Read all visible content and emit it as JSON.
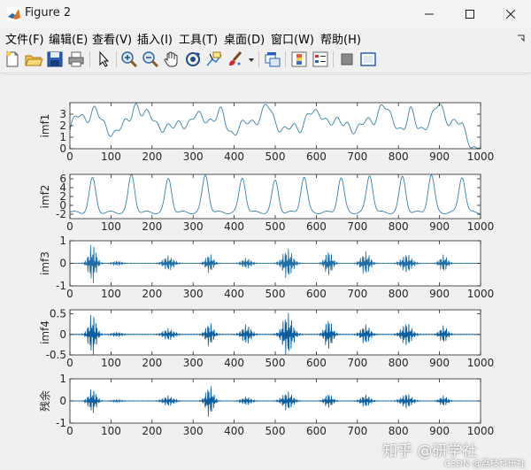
{
  "window": {
    "title": "Figure 2"
  },
  "menu": [
    "文件(F)",
    "编辑(E)",
    "查看(V)",
    "插入(I)",
    "工具(T)",
    "桌面(D)",
    "窗口(W)",
    "帮助(H)"
  ],
  "toolbar_icons": [
    "new-file-icon",
    "open-folder-icon",
    "save-icon",
    "print-icon",
    "pointer-icon",
    "zoom-in-icon",
    "zoom-out-icon",
    "pan-hand-icon",
    "rotate-3d-icon",
    "data-cursor-icon",
    "brush-icon",
    "brush-dropdown-icon",
    "link-plot-icon",
    "colorbar-icon",
    "legend-icon",
    "hide-plot-tools-icon",
    "show-plot-tools-icon"
  ],
  "chart_data": [
    {
      "type": "line",
      "ylabel": "imf1",
      "xlim": [
        0,
        1000
      ],
      "ylim": [
        0,
        4
      ],
      "yticks": [
        "0",
        "1",
        "2",
        "3"
      ],
      "xticks": [
        "0",
        "100",
        "200",
        "300",
        "400",
        "500",
        "600",
        "700",
        "800",
        "900",
        "1000"
      ],
      "style": "smooth",
      "series": [
        {
          "color": "#3a80a8"
        }
      ]
    },
    {
      "type": "line",
      "ylabel": "imf2",
      "xlim": [
        0,
        1000
      ],
      "ylim": [
        -3,
        7
      ],
      "yticks": [
        "-2",
        "0",
        "2",
        "4",
        "6"
      ],
      "xticks": [
        "0",
        "100",
        "200",
        "300",
        "400",
        "500",
        "600",
        "700",
        "800",
        "900",
        "1000"
      ],
      "style": "peaks",
      "series": [
        {
          "color": "#3a80a8"
        }
      ]
    },
    {
      "type": "line",
      "ylabel": "imf3",
      "xlim": [
        0,
        1000
      ],
      "ylim": [
        -1,
        1
      ],
      "yticks": [
        "-1",
        "0",
        "1"
      ],
      "xticks": [
        "0",
        "100",
        "200",
        "300",
        "400",
        "500",
        "600",
        "700",
        "800",
        "900",
        "1000"
      ],
      "style": "bursts",
      "series": [
        {
          "color": "#1f6fa6"
        }
      ]
    },
    {
      "type": "line",
      "ylabel": "imf4",
      "xlim": [
        0,
        1000
      ],
      "ylim": [
        -0.5,
        0.6
      ],
      "yticks": [
        "-0.5",
        "0",
        "0.5"
      ],
      "xticks": [
        "0",
        "100",
        "200",
        "300",
        "400",
        "500",
        "600",
        "700",
        "800",
        "900",
        "1000"
      ],
      "style": "bursts",
      "series": [
        {
          "color": "#0b5fa0"
        }
      ]
    },
    {
      "type": "line",
      "ylabel": "残余",
      "xlim": [
        0,
        1000
      ],
      "ylim": [
        -1,
        1
      ],
      "yticks": [
        "-1",
        "0",
        "1"
      ],
      "xticks": [
        "0",
        "100",
        "200",
        "300",
        "400",
        "500",
        "600",
        "700",
        "800",
        "900",
        "1000"
      ],
      "style": "bursts",
      "series": [
        {
          "color": "#0b5fa0"
        }
      ]
    }
  ],
  "watermark": {
    "main": "知乎 @研学社",
    "sub": "CSDN @荔枝科研社"
  }
}
